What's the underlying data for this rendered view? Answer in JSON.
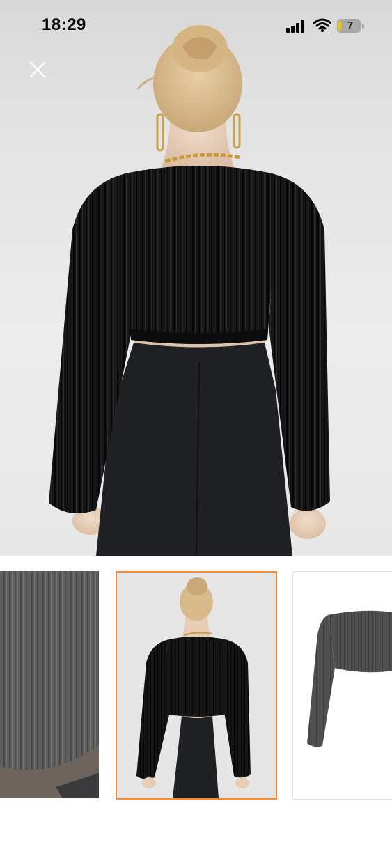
{
  "status_bar": {
    "time": "18:29",
    "battery_level": "7"
  },
  "icons": {
    "signal": "signal-bars-icon",
    "wifi": "wifi-icon",
    "battery": "battery-icon",
    "close": "close-icon"
  },
  "colors": {
    "selected_thumbnail_border": "#f0893c",
    "sweater": "#151515",
    "background": "#e8e8e8"
  },
  "gallery": {
    "thumbnails": [
      {
        "name": "ribbed-knit-closeup",
        "selected": false
      },
      {
        "name": "back-view-model",
        "selected": true
      },
      {
        "name": "sweater-flat-lay",
        "selected": false
      }
    ]
  }
}
